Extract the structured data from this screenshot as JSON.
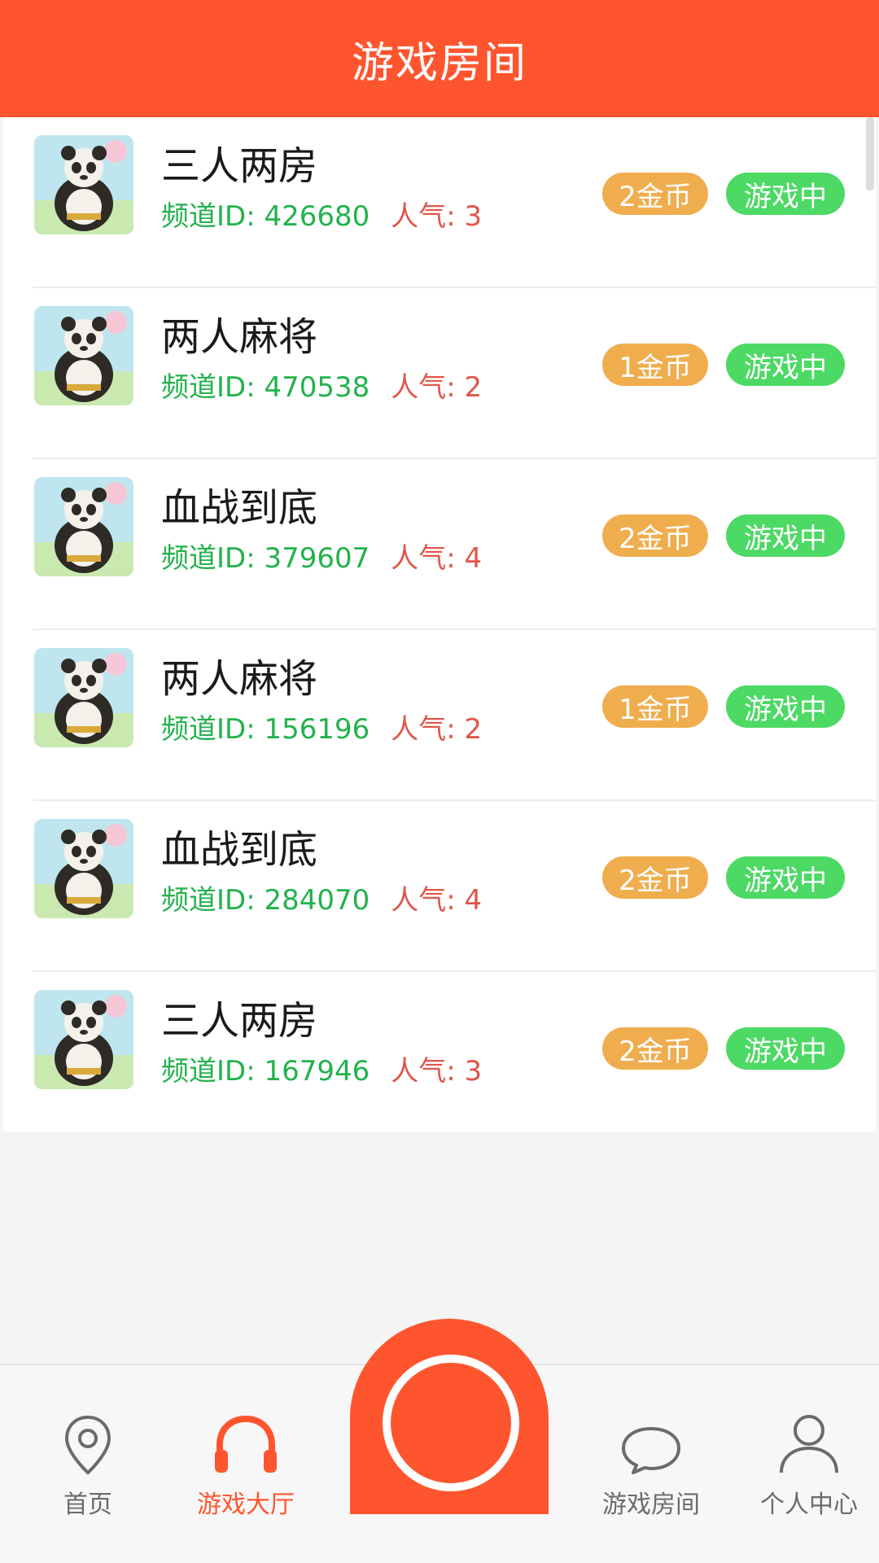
{
  "header": {
    "title": "游戏房间"
  },
  "rooms": [
    {
      "name": "三人两房",
      "channel_label": "频道ID: 426680",
      "popularity": "人气: 3",
      "cost": "2金币",
      "status": "游戏中"
    },
    {
      "name": "两人麻将",
      "channel_label": "频道ID: 470538",
      "popularity": "人气: 2",
      "cost": "1金币",
      "status": "游戏中"
    },
    {
      "name": "血战到底",
      "channel_label": "频道ID: 379607",
      "popularity": "人气: 4",
      "cost": "2金币",
      "status": "游戏中"
    },
    {
      "name": "两人麻将",
      "channel_label": "频道ID: 156196",
      "popularity": "人气: 2",
      "cost": "1金币",
      "status": "游戏中"
    },
    {
      "name": "血战到底",
      "channel_label": "频道ID: 284070",
      "popularity": "人气: 4",
      "cost": "2金币",
      "status": "游戏中"
    },
    {
      "name": "三人两房",
      "channel_label": "频道ID: 167946",
      "popularity": "人气: 3",
      "cost": "2金币",
      "status": "游戏中"
    }
  ],
  "tabbar": {
    "home": {
      "label": "首页",
      "icon": "location-pin-icon"
    },
    "hall": {
      "label": "游戏大厅",
      "icon": "headphones-icon",
      "active": true
    },
    "center": {
      "icon": "record-circle-icon"
    },
    "rooms": {
      "label": "游戏房间",
      "icon": "chat-bubble-icon"
    },
    "profile": {
      "label": "个人中心",
      "icon": "user-icon"
    }
  },
  "colors": {
    "brand": "#ff552e",
    "channel_text": "#22b24c",
    "popularity_text": "#e0564a",
    "coin_badge": "#f0ad4e",
    "status_badge": "#4cd964"
  }
}
